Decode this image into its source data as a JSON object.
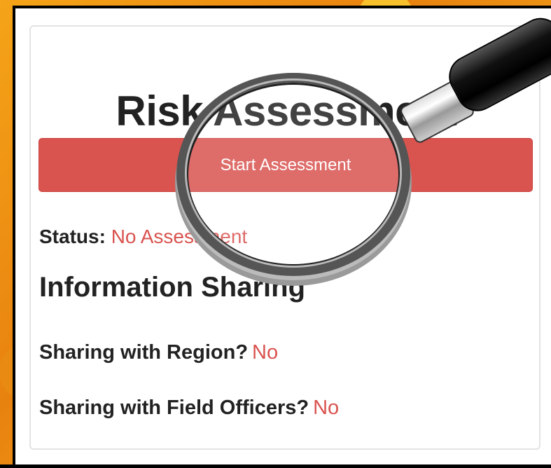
{
  "card": {
    "title": "Risk Assessment",
    "start_button_label": "Start Assessment",
    "status_label": "Status:",
    "status_value": "No Assessment",
    "section_heading": "Information Sharing",
    "sharing_region_label": "Sharing with Region?",
    "sharing_region_value": "No",
    "sharing_field_label": "Sharing with Field Officers?",
    "sharing_field_value": "No"
  },
  "icons": [
    "magnifying-glass-icon"
  ],
  "colors": {
    "accent_red": "#d9534f",
    "background_orange": "#f5a418"
  }
}
